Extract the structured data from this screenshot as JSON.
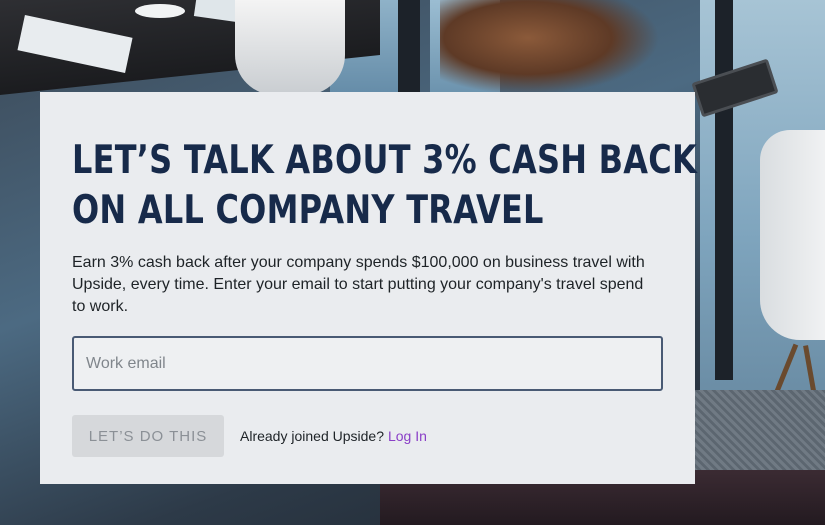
{
  "hero": {
    "headline_line1": "LET’S TALK ABOUT 3% CASH BACK",
    "headline_line2": "ON ALL COMPANY TRAVEL",
    "description": "Earn 3% cash back after your company spends $100,000 on business travel with Upside, every time. Enter your email to start putting your company's travel spend to work."
  },
  "form": {
    "email_placeholder": "Work email",
    "email_value": "",
    "submit_label": "LET’S DO THIS",
    "submit_state": "disabled"
  },
  "login": {
    "prompt": "Already joined Upside?",
    "link_label": "Log In"
  },
  "colors": {
    "headline": "#172a4a",
    "link": "#8a3fc7",
    "card_background": "#eaecef",
    "button_disabled": "#d6d8db"
  }
}
